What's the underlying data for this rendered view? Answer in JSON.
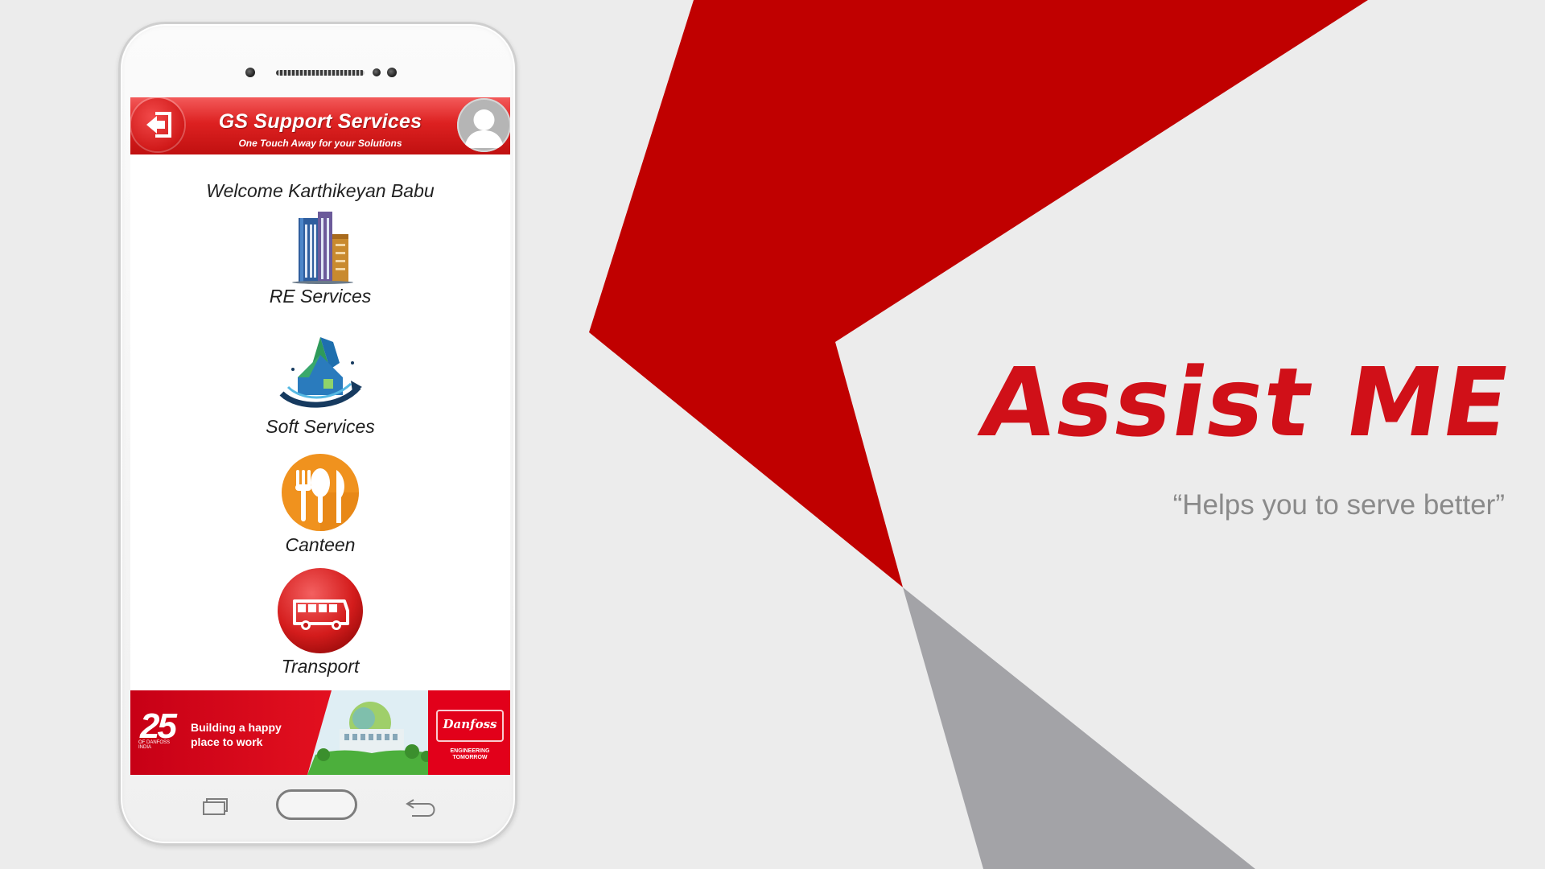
{
  "colors": {
    "brand_red": "#c00000",
    "title_red": "#d01018",
    "accent_gray": "#a3a3a7",
    "background": "#ececec",
    "tagline_gray": "#8a8a8a"
  },
  "hero": {
    "title": "Assist ME",
    "tagline": "“Helps you to serve better”"
  },
  "app": {
    "header": {
      "title": "GS Support Services",
      "subtitle": "One Touch Away for your Solutions",
      "left_icon": "logout-icon",
      "right_icon": "profile-avatar-icon"
    },
    "welcome": "Welcome Karthikeyan Babu",
    "menu": [
      {
        "label": "RE Services",
        "icon": "buildings-icon"
      },
      {
        "label": "Soft Services",
        "icon": "house-cleaning-icon"
      },
      {
        "label": "Canteen",
        "icon": "fork-spoon-knife-icon"
      },
      {
        "label": "Transport",
        "icon": "bus-icon"
      }
    ],
    "banner": {
      "badge": "25",
      "badge_caption": "OF DANFOSS INDIA",
      "text": "Building a happy place to work",
      "brand": "Danfoss",
      "brand_tagline": "ENGINEERING TOMORROW"
    }
  },
  "device_nav": {
    "recent_icon": "recent-apps-icon",
    "home_icon": "home-button",
    "back_icon": "back-arrow-icon"
  }
}
